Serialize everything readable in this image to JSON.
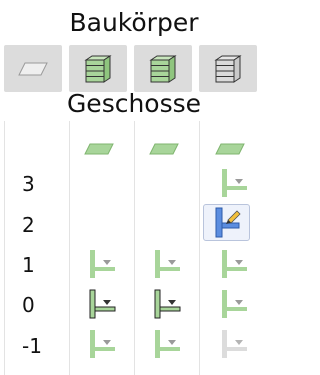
{
  "headers": {
    "baukoerper": "Baukörper",
    "geschosse": "Geschosse"
  },
  "columns": [
    {
      "icon": "slab-outline-icon"
    },
    {
      "icon": "building-green-icon"
    },
    {
      "icon": "building-green-icon"
    },
    {
      "icon": "building-gray-icon"
    }
  ],
  "floors": [
    {
      "label": "3"
    },
    {
      "label": "2"
    },
    {
      "label": "1"
    },
    {
      "label": "0"
    },
    {
      "label": "-1"
    }
  ],
  "colors": {
    "green": "#a8d59a",
    "green_dark": "#5e9e4e",
    "blue_selected": "#5b8de0",
    "header_bg": "#dcdcdc",
    "gray_icon": "#cfcfcf"
  }
}
